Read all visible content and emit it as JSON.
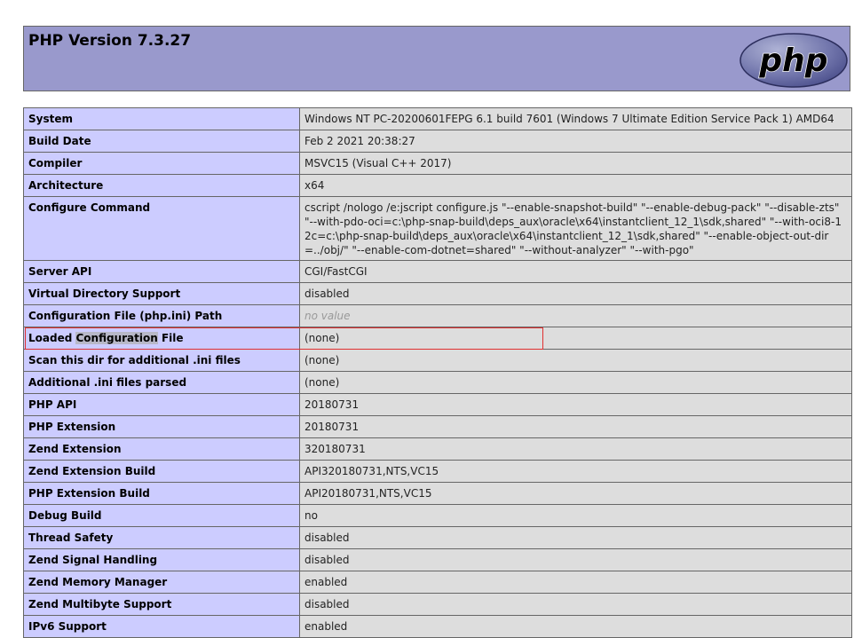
{
  "header": {
    "title": "PHP Version 7.3.27",
    "logo_text": "php",
    "logo_color": "#7377ad",
    "bg_color": "#9999cc"
  },
  "table": {
    "rows": [
      {
        "key": "System",
        "value": "Windows NT PC-20200601FEPG 6.1 build 7601 (Windows 7 Ultimate Edition Service Pack 1) AMD64"
      },
      {
        "key": "Build Date",
        "value": "Feb 2 2021 20:38:27"
      },
      {
        "key": "Compiler",
        "value": "MSVC15 (Visual C++ 2017)"
      },
      {
        "key": "Architecture",
        "value": "x64"
      },
      {
        "key": "Configure Command",
        "value": "cscript /nologo /e:jscript configure.js \"--enable-snapshot-build\" \"--enable-debug-pack\" \"--disable-zts\" \"--with-pdo-oci=c:\\php-snap-build\\deps_aux\\oracle\\x64\\instantclient_12_1\\sdk,shared\" \"--with-oci8-12c=c:\\php-snap-build\\deps_aux\\oracle\\x64\\instantclient_12_1\\sdk,shared\" \"--enable-object-out-dir=../obj/\" \"--enable-com-dotnet=shared\" \"--without-analyzer\" \"--with-pgo\""
      },
      {
        "key": "Server API",
        "value": "CGI/FastCGI"
      },
      {
        "key": "Virtual Directory Support",
        "value": "disabled"
      },
      {
        "key": "Configuration File (php.ini) Path",
        "value": "no value"
      },
      {
        "key_before": "Loaded ",
        "key_highlight": "Configuration",
        "key_after": " File",
        "value": "(none)"
      },
      {
        "key": "Scan this dir for additional .ini files",
        "value": "(none)"
      },
      {
        "key": "Additional .ini files parsed",
        "value": "(none)"
      },
      {
        "key": "PHP API",
        "value": "20180731"
      },
      {
        "key": "PHP Extension",
        "value": "20180731"
      },
      {
        "key": "Zend Extension",
        "value": "320180731"
      },
      {
        "key": "Zend Extension Build",
        "value": "API320180731,NTS,VC15"
      },
      {
        "key": "PHP Extension Build",
        "value": "API20180731,NTS,VC15"
      },
      {
        "key": "Debug Build",
        "value": "no"
      },
      {
        "key": "Thread Safety",
        "value": "disabled"
      },
      {
        "key": "Zend Signal Handling",
        "value": "disabled"
      },
      {
        "key": "Zend Memory Manager",
        "value": "enabled"
      },
      {
        "key": "Zend Multibyte Support",
        "value": "disabled"
      },
      {
        "key": "IPv6 Support",
        "value": "enabled"
      }
    ]
  },
  "colors": {
    "key_bg": "#ccccff",
    "value_bg": "#dddddd",
    "highlight_border": "#e03030"
  }
}
